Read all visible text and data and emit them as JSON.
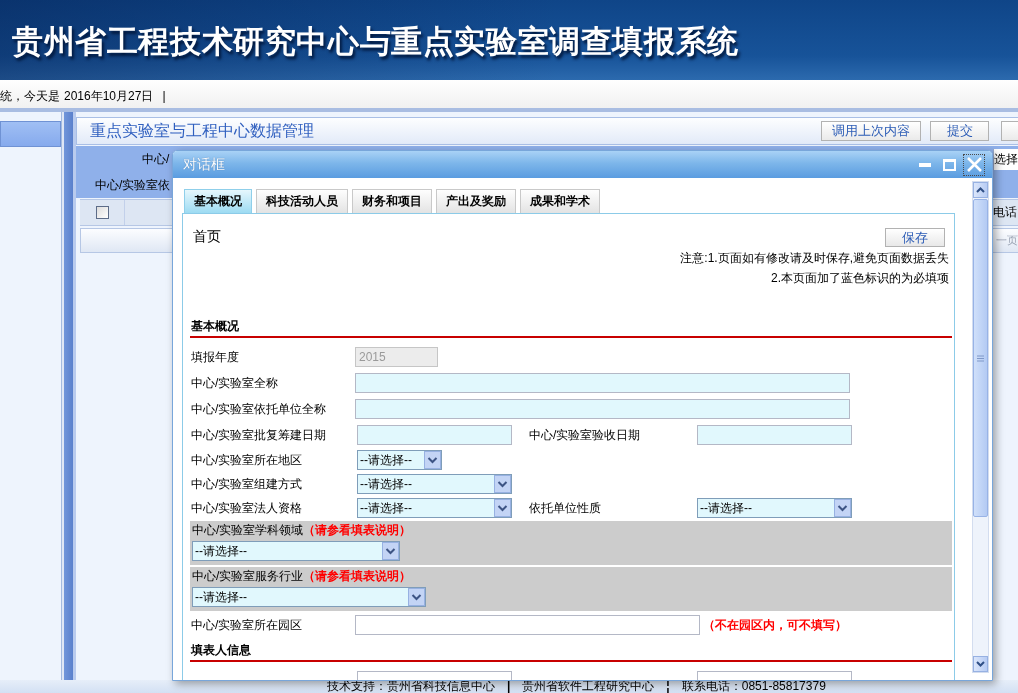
{
  "header": {
    "title": "贵州省工程技术研究中心与重点实验室调查填报系统"
  },
  "info_bar": {
    "greeting": "统，今天是",
    "date": "2016年10月27日",
    "separator": "|"
  },
  "main_panel": {
    "title": "重点实验室与工程中心数据管理",
    "buttons": [
      "调用上次内容",
      "提交"
    ],
    "filters": {
      "labels": [
        "中心/",
        "中心/实验室依"
      ],
      "select_value": "选择"
    },
    "table": {
      "select_all": {
        "checked": false
      },
      "column_2": "电话"
    },
    "pager": {
      "button": {
        "label": "一页",
        "disabled": true
      }
    }
  },
  "dialog": {
    "title": "对话框",
    "tabs": [
      {
        "label": "基本概况",
        "selected": true
      },
      {
        "label": "科技活动人员",
        "selected": false
      },
      {
        "label": "财务和项目",
        "selected": false
      },
      {
        "label": "产出及奖励",
        "selected": false
      },
      {
        "label": "成果和学术",
        "selected": false
      }
    ],
    "page": {
      "title": "首页",
      "save_button": "保存",
      "notes": [
        "注意:1.页面如有修改请及时保存,避免页面数据丢失",
        "2.本页面加了蓝色标识的为必填项"
      ],
      "sections": [
        {
          "title": "基本概况",
          "rows": [
            {
              "kind": "line",
              "fields": [
                {
                  "label": "填报年度",
                  "kind": "input",
                  "value": "2015",
                  "required": false,
                  "disabled": true
                }
              ]
            },
            {
              "kind": "line",
              "fields": [
                {
                  "label": "中心/实验室全称",
                  "kind": "input",
                  "required": true,
                  "disabled": false
                }
              ]
            },
            {
              "kind": "line",
              "fields": [
                {
                  "label": "中心/实验室依托单位全称",
                  "kind": "input",
                  "required": true,
                  "disabled": false
                }
              ]
            },
            {
              "kind": "line",
              "fields": [
                {
                  "label": "中心/实验室批复筹建日期",
                  "kind": "input",
                  "required": true,
                  "disabled": false
                },
                {
                  "label": "中心/实验室验收日期",
                  "kind": "input",
                  "required": true,
                  "disabled": false
                }
              ]
            },
            {
              "kind": "line",
              "fields": [
                {
                  "label": "中心/实验室所在地区",
                  "kind": "select",
                  "value": "--请选择--",
                  "required": true,
                  "disabled": false
                }
              ]
            },
            {
              "kind": "line",
              "fields": [
                {
                  "label": "中心/实验室组建方式",
                  "kind": "select",
                  "value": "--请选择--",
                  "required": true,
                  "disabled": false
                }
              ]
            },
            {
              "kind": "line",
              "fields": [
                {
                  "label": "中心/实验室法人资格",
                  "kind": "select",
                  "value": "--请选择--",
                  "required": true,
                  "disabled": false
                },
                {
                  "label": "依托单位性质",
                  "kind": "select",
                  "value": "--请选择--",
                  "required": true,
                  "disabled": false
                }
              ]
            },
            {
              "kind": "block",
              "fields": [
                {
                  "label": "中心/实验室学科领域",
                  "hint": "（请参看填表说明）",
                  "kind": "select",
                  "value": "--请选择--",
                  "required": true,
                  "disabled": false
                }
              ]
            },
            {
              "kind": "block",
              "fields": [
                {
                  "label": "中心/实验室服务行业",
                  "hint": "（请参看填表说明）",
                  "kind": "select",
                  "value": "--请选择--",
                  "required": true,
                  "disabled": false
                }
              ]
            },
            {
              "kind": "line",
              "fields": [
                {
                  "label": "中心/实验室所在园区",
                  "kind": "input",
                  "required": false,
                  "disabled": false,
                  "hint": "（不在园区内，可不填写）"
                }
              ]
            }
          ]
        },
        {
          "title": "填表人信息",
          "rows": [
            {
              "kind": "line",
              "fields": [
                {
                  "kind": "input",
                  "required": false,
                  "disabled": false
                },
                {
                  "kind": "input",
                  "required": false,
                  "disabled": false
                }
              ]
            }
          ]
        }
      ]
    }
  },
  "footer": {
    "items": [
      {
        "kind": "text",
        "text": "技术支持：贵州省科技信息中心"
      },
      {
        "kind": "separator",
        "text": "|"
      },
      {
        "kind": "text",
        "text": "贵州省软件工程研究中心"
      },
      {
        "kind": "separator",
        "text": "¦"
      },
      {
        "kind": "text",
        "text": "联系电话：0851-85817379"
      }
    ]
  }
}
